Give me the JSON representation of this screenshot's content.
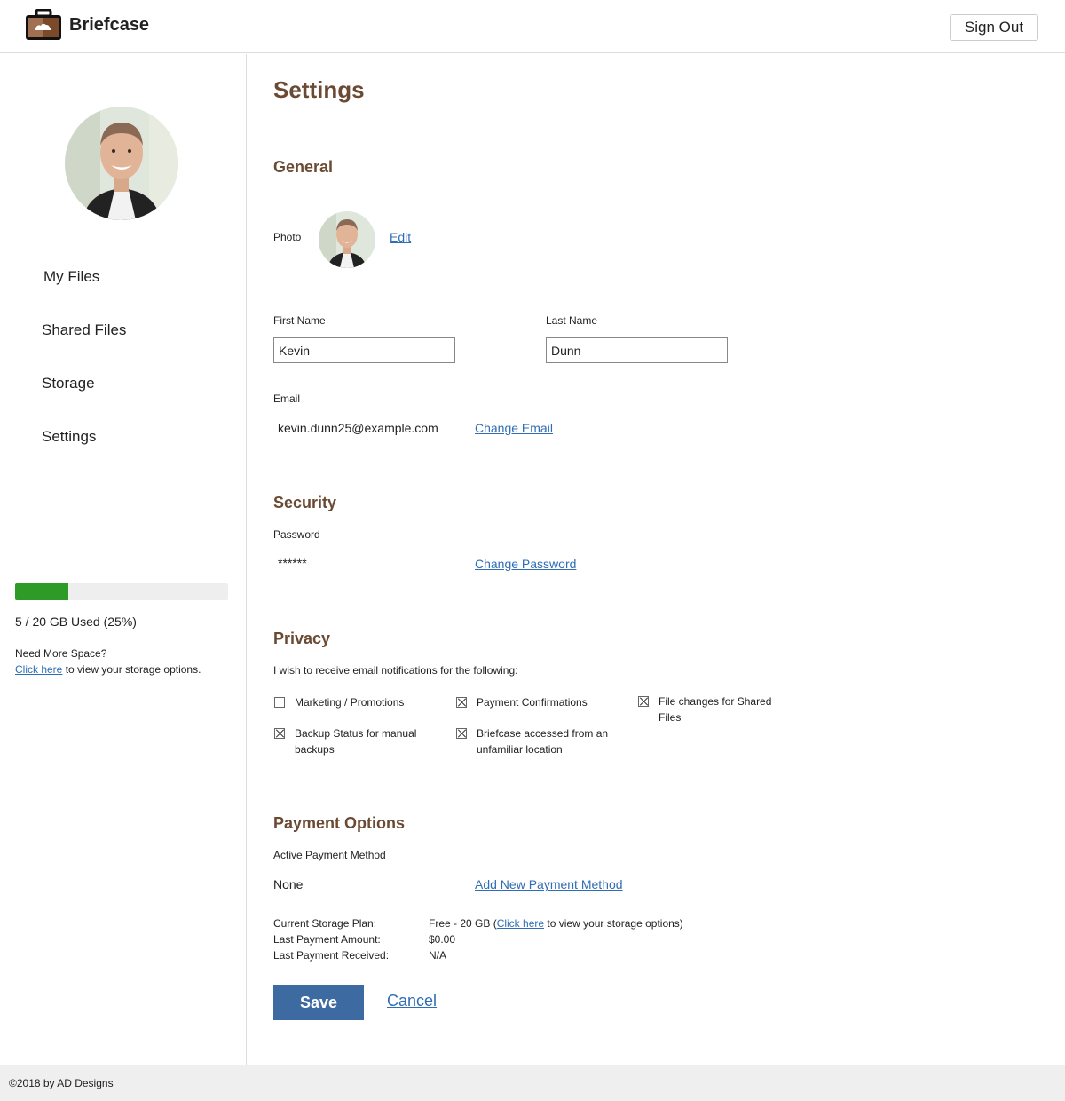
{
  "header": {
    "brand": "Briefcase",
    "sign_out": "Sign Out"
  },
  "sidebar": {
    "nav": [
      {
        "label": "My Files"
      },
      {
        "label": "Shared Files"
      },
      {
        "label": "Storage"
      },
      {
        "label": "Settings"
      }
    ],
    "storage": {
      "used_fraction": 0.25,
      "used_text": "5 / 20 GB Used (25%)",
      "need_more": "Need More Space?",
      "click_here": "Click here",
      "view_options": " to view your storage options."
    }
  },
  "settings": {
    "title": "Settings",
    "general": {
      "heading": "General",
      "photo_label": "Photo",
      "edit": "Edit",
      "first_name_label": "First Name",
      "first_name": "Kevin",
      "last_name_label": "Last Name",
      "last_name": "Dunn",
      "email_label": "Email",
      "email": "kevin.dunn25@example.com",
      "change_email": "Change Email"
    },
    "security": {
      "heading": "Security",
      "password_label": "Password",
      "password": "******",
      "change_password": "Change Password"
    },
    "privacy": {
      "heading": "Privacy",
      "intro": "I wish to receive email notifications for the following:",
      "options": [
        {
          "label": "Marketing / Promotions",
          "checked": false
        },
        {
          "label": "Payment Confirmations",
          "checked": true
        },
        {
          "label": "File changes for Shared Files",
          "checked": true
        },
        {
          "label": "Backup Status for manual backups",
          "checked": true
        },
        {
          "label": "Briefcase accessed from an unfamiliar location",
          "checked": true
        }
      ]
    },
    "payment": {
      "heading": "Payment Options",
      "active_label": "Active Payment Method",
      "active_value": "None",
      "add_new": "Add New Payment Method",
      "plan_label": "Current Storage Plan:",
      "plan_prefix": "Free - 20 GB (",
      "plan_link": "Click here",
      "plan_suffix": " to view your storage options)",
      "last_amount_label": "Last Payment Amount:",
      "last_amount": "$0.00",
      "last_received_label": "Last Payment Received:",
      "last_received": "N/A"
    },
    "save": "Save",
    "cancel": "Cancel"
  },
  "footer": {
    "copyright": "©2018 by AD Designs"
  },
  "colors": {
    "accent_brown": "#6b4a33",
    "link_blue": "#2f6db5",
    "save_blue": "#3c6aa1",
    "storage_green": "#2e9b27"
  }
}
